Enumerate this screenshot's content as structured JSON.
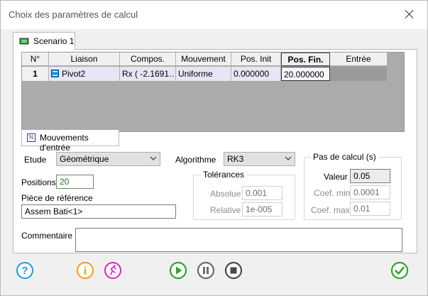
{
  "window": {
    "title": "Choix des paramètres de calcul"
  },
  "tabs": {
    "scenario": "Scenario 1",
    "mouvements": "Mouvements d'entrée"
  },
  "grid": {
    "headers": [
      "N°",
      "Liaison",
      "Compos.",
      "Mouvement",
      "Pos. Init",
      "Pos. Fin.",
      "Entrée"
    ],
    "row": {
      "n": "1",
      "liaison": "Pivot2",
      "compos": "Rx ( -2.1691…",
      "mouvement": "Uniforme",
      "pos_init": "0.000000",
      "pos_fin": "20.000000",
      "entree": ""
    }
  },
  "form": {
    "etude_label": "Etude",
    "etude_value": "Géométrique",
    "algorithme_label": "Algorithme",
    "algorithme_value": "RK3",
    "positions_label": "Positions",
    "positions_value": "20",
    "piece_label": "Pièce de référence",
    "piece_value": "Assem Bati<1>",
    "tolerances_title": "Tolérances",
    "absolue_label": "Absolue",
    "absolue_value": "0.001",
    "relative_label": "Relative",
    "relative_value": "1e-005",
    "pas_title": "Pas de calcul (s)",
    "valeur_label": "Valeur",
    "valeur_value": "0.05",
    "coef_mini_label": "Coef. mini",
    "coef_mini_value": "0.0001",
    "coef_maxi_label": "Coef. maxi",
    "coef_maxi_value": "0.01",
    "commentaire_label": "Commentaire",
    "commentaire_value": ""
  },
  "colors": {
    "accent_blue": "#1e9be0",
    "accent_orange": "#f39c12",
    "accent_magenta": "#e020c8",
    "accent_green": "#2fa52f",
    "gray_btn": "#6a6a6a"
  },
  "icons": [
    "help-icon",
    "info-icon",
    "run-icon",
    "play-icon",
    "pause-icon",
    "stop-icon",
    "ok-icon"
  ]
}
